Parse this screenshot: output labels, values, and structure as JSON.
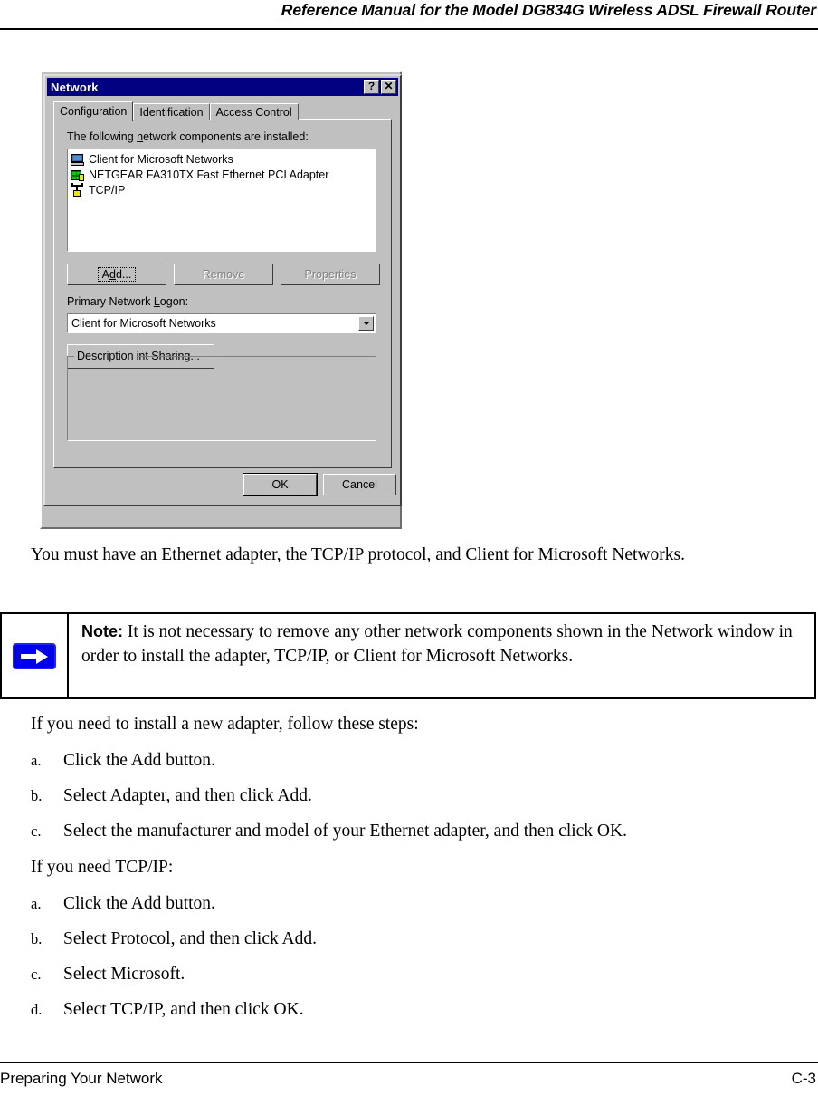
{
  "header": {
    "running_title": "Reference Manual for the Model DG834G Wireless ADSL Firewall Router"
  },
  "figure": {
    "dialog": {
      "title": "Network",
      "titlebar_buttons": [
        {
          "name": "help-button",
          "glyph": "?"
        },
        {
          "name": "close-button",
          "glyph": "✕"
        }
      ],
      "tabs": [
        {
          "label": "Configuration",
          "active": true
        },
        {
          "label": "Identification",
          "active": false
        },
        {
          "label": "Access Control",
          "active": false
        }
      ],
      "components_label_pre": "The following ",
      "components_label_mnemonic": "n",
      "components_label_post": "etwork components are installed:",
      "components": [
        {
          "icon": "monitor-icon",
          "label": "Client for Microsoft Networks"
        },
        {
          "icon": "network-adapter-icon",
          "label": "NETGEAR FA310TX Fast Ethernet PCI Adapter"
        },
        {
          "icon": "protocol-icon",
          "label": "TCP/IP"
        }
      ],
      "buttons": {
        "add": {
          "label_pre": "A",
          "label_mnemonic": "d",
          "label_post": "d...",
          "full": "Add...",
          "state": "focused"
        },
        "remove": {
          "full": "Remove",
          "state": "disabled"
        },
        "properties": {
          "full": "Properties",
          "state": "disabled"
        },
        "file_print_sharing": {
          "full": "File and Print Sharing...",
          "state": "enabled"
        },
        "ok": {
          "full": "OK",
          "state": "default"
        },
        "cancel": {
          "full": "Cancel",
          "state": "enabled"
        }
      },
      "primary_logon": {
        "label_pre": "Primary Network ",
        "label_mnemonic": "L",
        "label_post": "ogon:",
        "selected": "Client for Microsoft Networks",
        "options": [
          "Client for Microsoft Networks"
        ]
      },
      "description_group": {
        "title": "Description",
        "text": ""
      }
    }
  },
  "body": {
    "intro_paragraph": "You must have an Ethernet adapter, the TCP/IP protocol, and Client for Microsoft Networks.",
    "note": {
      "label": "Note:",
      "text": " It is not necessary to remove any other network components shown in the Network window in order to install the adapter, TCP/IP, or Client for Microsoft Networks.",
      "icon": "blue-right-arrow-icon"
    },
    "section_adapter": {
      "lead": "If you need to install a new adapter, follow these steps:",
      "steps": [
        {
          "marker": "a.",
          "text": "Click the Add button."
        },
        {
          "marker": "b.",
          "text": "Select Adapter, and then click Add."
        },
        {
          "marker": "c.",
          "text": "Select the manufacturer and model of your Ethernet adapter, and then click OK."
        }
      ]
    },
    "section_tcpip": {
      "lead": "If you need TCP/IP:",
      "steps": [
        {
          "marker": "a.",
          "text": "Click the Add button."
        },
        {
          "marker": "b.",
          "text": "Select Protocol, and then click Add."
        },
        {
          "marker": "c.",
          "text": "Select Microsoft."
        },
        {
          "marker": "d.",
          "text": "Select TCP/IP, and then click OK."
        }
      ]
    }
  },
  "footer": {
    "left": "Preparing Your Network",
    "right": "C-3"
  },
  "colors": {
    "titlebar": "#000080",
    "dialog_face": "#c0c0c0",
    "note_arrow": "#0000ee"
  }
}
